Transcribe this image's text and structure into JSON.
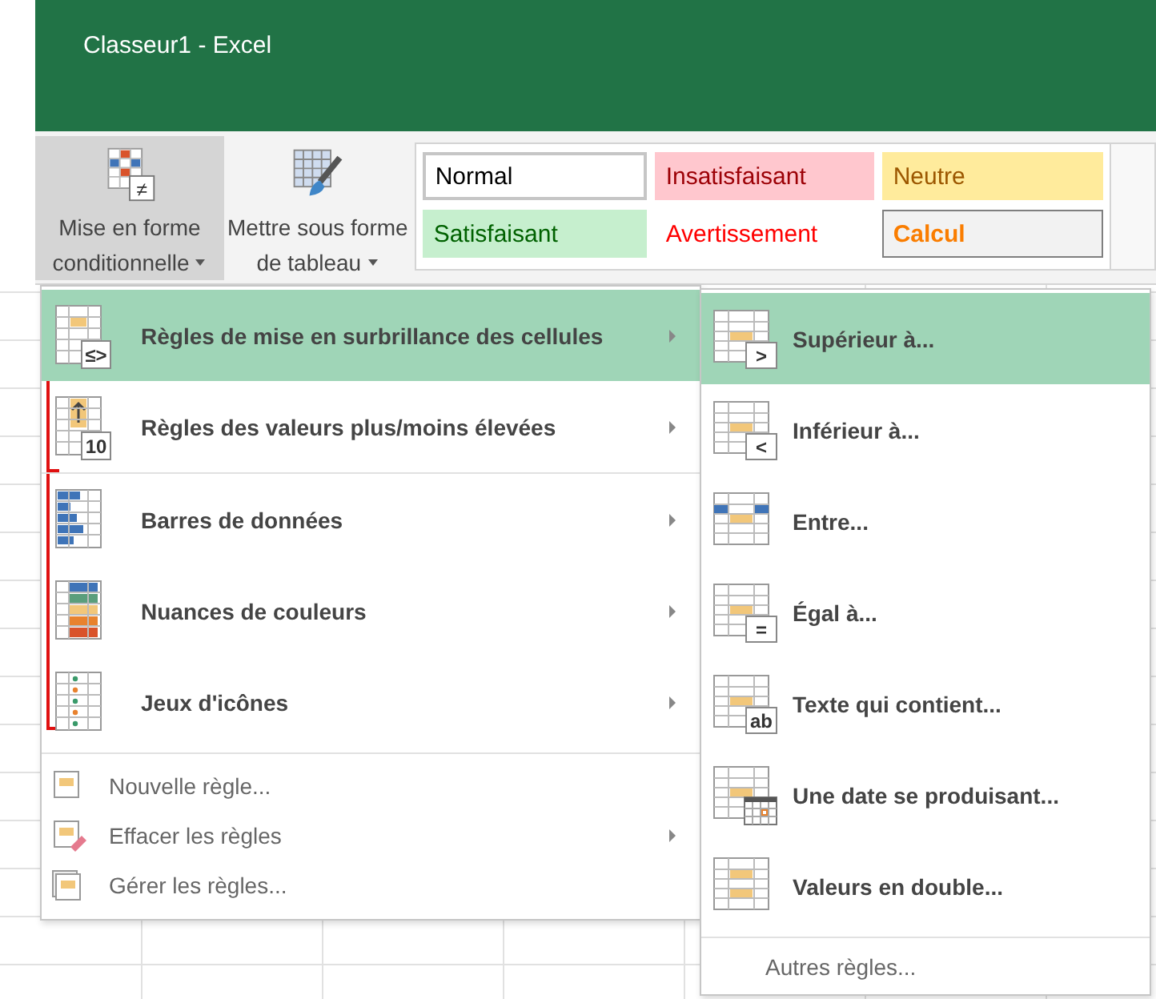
{
  "window": {
    "title": "Classeur1 - Excel"
  },
  "ribbon": {
    "buttons": [
      {
        "lines": [
          "Mise en forme",
          "conditionnelle"
        ],
        "badge": "≠",
        "selected": true
      },
      {
        "lines": [
          "Mettre sous forme",
          "de tableau"
        ],
        "selected": false
      }
    ],
    "cell_styles": [
      {
        "label": "Normal",
        "kind": "normal"
      },
      {
        "label": "Insatisfaisant",
        "kind": "bad"
      },
      {
        "label": "Neutre",
        "kind": "neutral"
      },
      {
        "label": "Satisfaisant",
        "kind": "good"
      },
      {
        "label": "Avertissement",
        "kind": "warning"
      },
      {
        "label": "Calcul",
        "kind": "calc"
      }
    ]
  },
  "menu": {
    "items": [
      {
        "label": "Règles de mise en surbrillance des cellules",
        "kind": "large",
        "badge": "≤>",
        "submenu": true,
        "selected": true
      },
      {
        "label": "Règles des valeurs plus/moins élevées",
        "kind": "large",
        "badge": "10",
        "submenu": true,
        "selected": false
      },
      {
        "label": "Barres de données",
        "kind": "large",
        "submenu": true,
        "selected": false
      },
      {
        "label": "Nuances de couleurs",
        "kind": "large",
        "submenu": true,
        "selected": false
      },
      {
        "label": "Jeux d'icônes",
        "kind": "large",
        "submenu": true,
        "selected": false
      },
      {
        "label": "Nouvelle règle...",
        "kind": "small",
        "submenu": false,
        "selected": false
      },
      {
        "label": "Effacer les règles",
        "kind": "small",
        "submenu": true,
        "selected": false
      },
      {
        "label": "Gérer les règles...",
        "kind": "small",
        "submenu": false,
        "selected": false
      }
    ]
  },
  "submenu": {
    "items": [
      {
        "label": "Supérieur à...",
        "kind": "compare",
        "badge": ">",
        "selected": true
      },
      {
        "label": "Inférieur à...",
        "kind": "compare",
        "badge": "<",
        "selected": false
      },
      {
        "label": "Entre...",
        "kind": "between",
        "selected": false
      },
      {
        "label": "Égal à...",
        "kind": "compare",
        "badge": "=",
        "selected": false
      },
      {
        "label": "Texte qui contient...",
        "kind": "compare",
        "badge": "ab",
        "selected": false
      },
      {
        "label": "Une date se produisant...",
        "kind": "date",
        "selected": false
      },
      {
        "label": "Valeurs en double...",
        "kind": "duplicate",
        "selected": false
      }
    ],
    "footer": "Autres règles..."
  }
}
